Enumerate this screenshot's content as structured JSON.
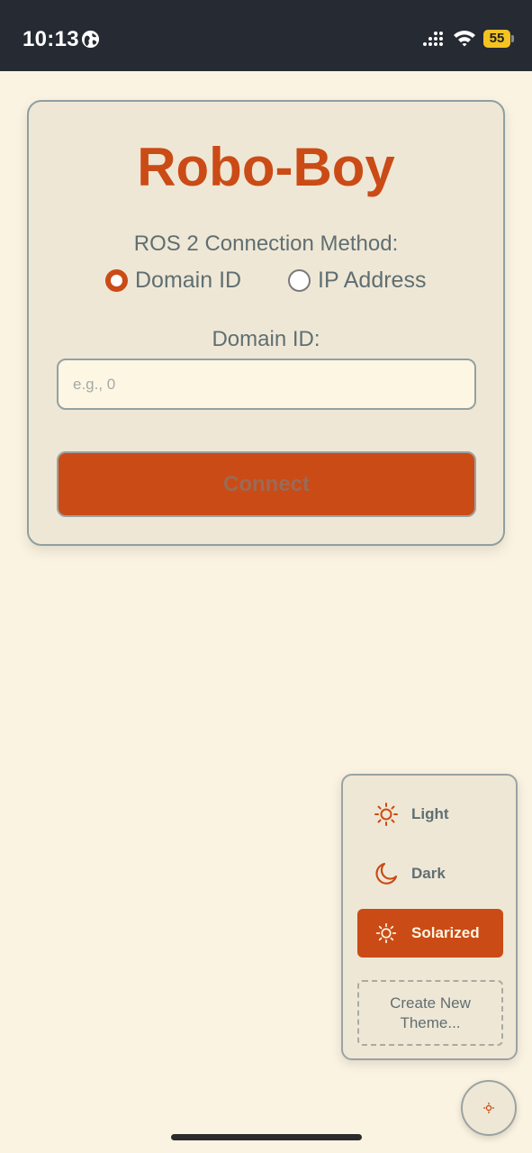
{
  "status_bar": {
    "time": "10:13",
    "battery": "55",
    "icons": [
      "globe-icon",
      "cellular-signal-icon",
      "wifi-icon",
      "battery-icon"
    ]
  },
  "card": {
    "title": "Robo-Boy",
    "connection_method_label": "ROS 2 Connection Method:",
    "options": [
      {
        "label": "Domain ID",
        "selected": true
      },
      {
        "label": "IP Address",
        "selected": false
      }
    ],
    "domain_id_label": "Domain ID:",
    "domain_id_input": {
      "value": "",
      "placeholder": "e.g., 0"
    },
    "connect_label": "Connect"
  },
  "theme_menu": {
    "items": [
      {
        "label": "Light",
        "icon": "sun-icon",
        "active": false
      },
      {
        "label": "Dark",
        "icon": "moon-icon",
        "active": false
      },
      {
        "label": "Solarized",
        "icon": "sun-icon",
        "active": true
      }
    ],
    "create_label_line1": "Create New",
    "create_label_line2": "Theme..."
  },
  "fab": {
    "icon": "sun-icon"
  },
  "colors": {
    "background": "#fbf3e1",
    "card": "#efe7d5",
    "accent": "#cb4b16",
    "text": "#5f6f72",
    "status_bar": "#262a33",
    "battery": "#f3c322"
  }
}
